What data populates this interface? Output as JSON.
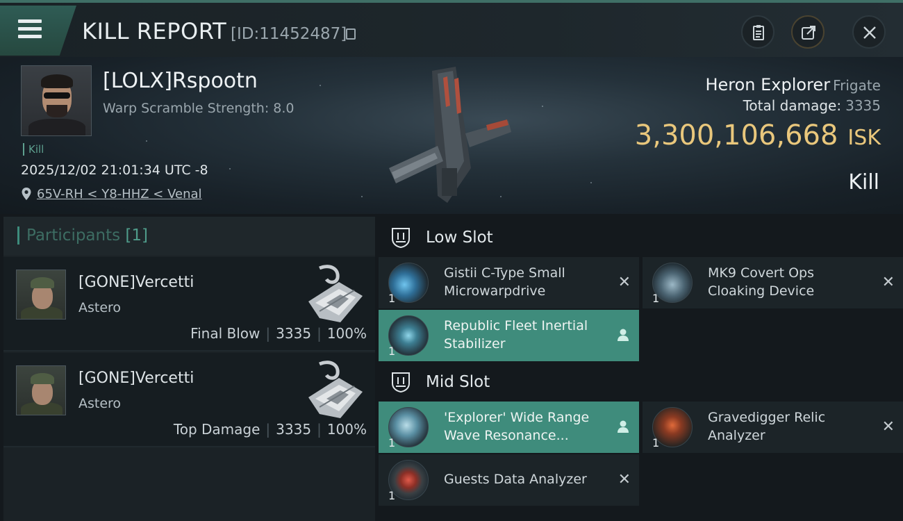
{
  "header": {
    "title": "KILL REPORT",
    "id_label": "[ID:11452487]",
    "menu_icon": "hamburger-icon",
    "actions": [
      "clipboard-icon",
      "share-icon",
      "close-icon"
    ]
  },
  "victim": {
    "name": "[LOLX]Rspootn",
    "scramble": "Warp Scramble Strength: 8.0",
    "tag": "Kill",
    "timestamp": "2025/12/02 21:01:34 UTC -8",
    "location": "65V-RH < Y8-HHZ < Venal",
    "ship_name": "Heron Explorer",
    "ship_class": "Frigate",
    "total_damage_label": "Total damage:",
    "total_damage": "3335",
    "isk_value": "3,300,106,668",
    "isk_unit": "ISK",
    "result": "Kill"
  },
  "participants": {
    "title": "Participants",
    "count": "[1]",
    "rows": [
      {
        "name": "[GONE]Vercetti",
        "ship": "Astero",
        "label": "Final Blow",
        "damage": "3335",
        "percent": "100%"
      },
      {
        "name": "[GONE]Vercetti",
        "ship": "Astero",
        "label": "Top Damage",
        "damage": "3335",
        "percent": "100%"
      }
    ]
  },
  "slots": {
    "low": {
      "title": "Low Slot",
      "modules": [
        {
          "name": "Gistii C-Type Small Microwarpdrive",
          "qty": "1",
          "state": "destroyed"
        },
        {
          "name": "MK9 Covert Ops Cloaking Device",
          "qty": "1",
          "state": "destroyed"
        },
        {
          "name": "Republic Fleet Inertial Stabilizer",
          "qty": "1",
          "state": "dropped"
        }
      ]
    },
    "mid": {
      "title": "Mid Slot",
      "modules": [
        {
          "name": "'Explorer' Wide Range Wave Resonance...",
          "qty": "1",
          "state": "dropped"
        },
        {
          "name": "Gravedigger Relic Analyzer",
          "qty": "1",
          "state": "destroyed"
        },
        {
          "name": "Guests Data Analyzer",
          "qty": "1",
          "state": "destroyed"
        }
      ]
    }
  },
  "colors": {
    "accent": "#3f8c7c",
    "isk": "#e9c77c",
    "background": "#14191d"
  }
}
